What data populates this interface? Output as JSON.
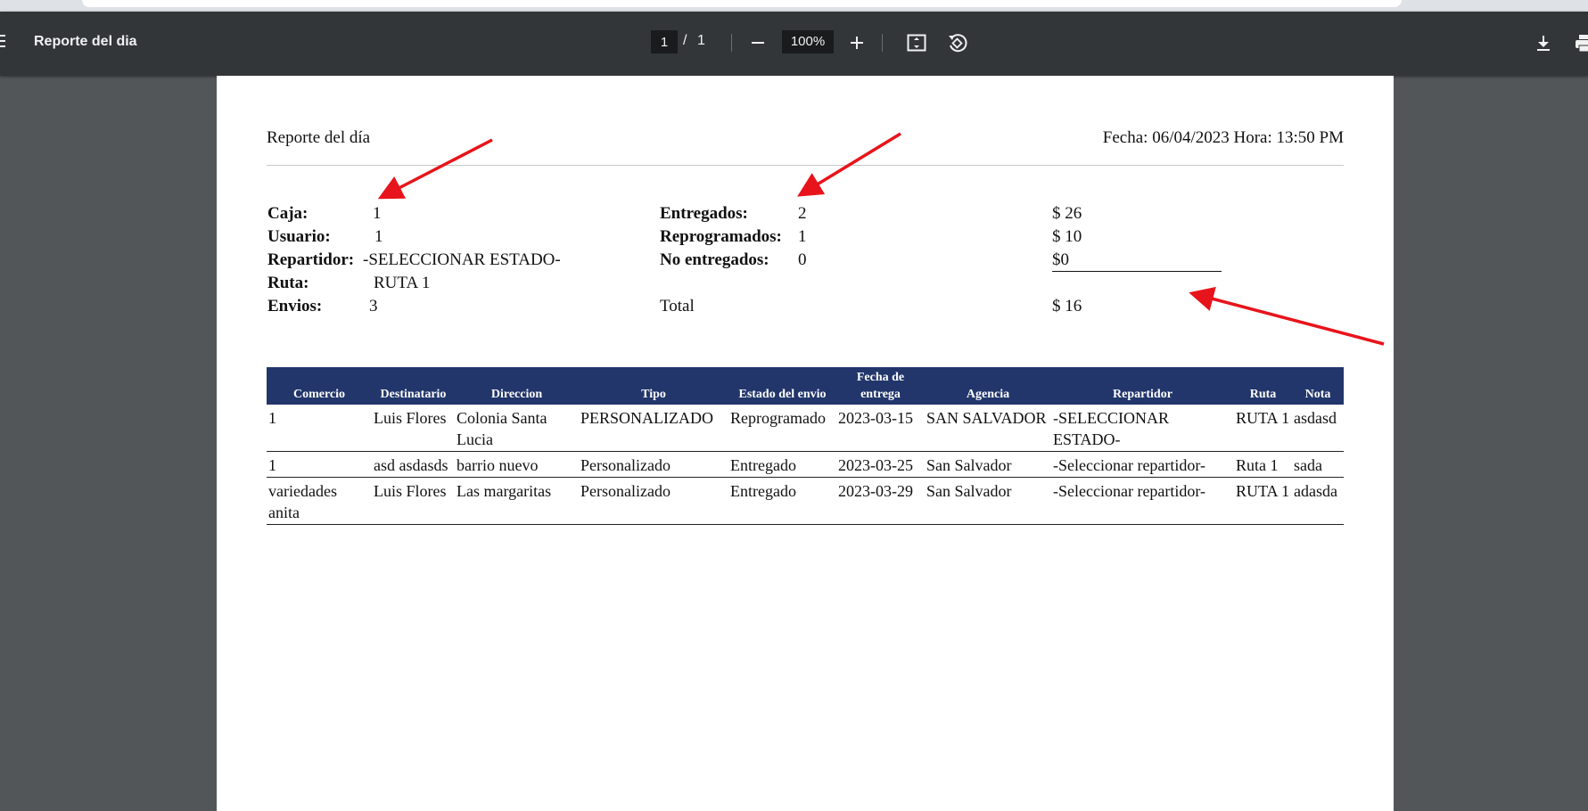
{
  "toolbar": {
    "title": "Reporte del dia",
    "page_current": "1",
    "page_separator": "/",
    "page_total": "1",
    "zoom": "100%"
  },
  "report": {
    "title": "Reporte del día",
    "date": "Fecha: 06/04/2023 Hora: 13:50 PM",
    "summary_left": [
      {
        "label": "Caja:",
        "value": "1"
      },
      {
        "label": "Usuario:",
        "value": "1"
      },
      {
        "label": "Repartidor:",
        "value": "-SELECCIONAR ESTADO-"
      },
      {
        "label": "Ruta:",
        "value": "RUTA 1"
      },
      {
        "label": "Envios:",
        "value": "3"
      }
    ],
    "summary_mid": [
      {
        "label": "Entregados:",
        "value": "2"
      },
      {
        "label": "Reprogramados:",
        "value": "1"
      },
      {
        "label": "No entregados:",
        "value": "0"
      },
      {
        "label": "Total",
        "value": ""
      }
    ],
    "summary_amounts": [
      "$ 26",
      "$ 10",
      "$0",
      "$ 16"
    ]
  },
  "table": {
    "headers": [
      "Comercio",
      "Destinatario",
      "Direccion",
      "Tipo",
      "Estado del envio",
      "Fecha de entrega",
      "Agencia",
      "Repartidor",
      "Ruta",
      "Nota"
    ],
    "rows": [
      [
        "1",
        "Luis Flores",
        "Colonia Santa Lucia",
        "PERSONALIZADO",
        "Reprogramado",
        "2023-03-15",
        "SAN SALVADOR",
        "-SELECCIONAR ESTADO-",
        "RUTA 1",
        "asdasd"
      ],
      [
        "1",
        "asd asdasds",
        "barrio nuevo",
        "Personalizado",
        "Entregado",
        "2023-03-25",
        "San Salvador",
        "-Seleccionar repartidor-",
        "Ruta 1",
        "sada"
      ],
      [
        "variedades anita",
        "Luis Flores",
        "Las margaritas",
        "Personalizado",
        "Entregado",
        "2023-03-29",
        "San Salvador",
        "-Seleccionar repartidor-",
        "RUTA 1",
        "adasda"
      ]
    ]
  },
  "colors": {
    "toolbar_bg": "#323639",
    "viewer_bg": "#525659",
    "table_header_bg": "#22366b",
    "annotation_arrow": "#e8141b"
  },
  "icons": [
    "menu-icon",
    "zoom-out-icon",
    "zoom-in-icon",
    "fit-page-icon",
    "rotate-icon",
    "download-icon",
    "print-icon"
  ]
}
